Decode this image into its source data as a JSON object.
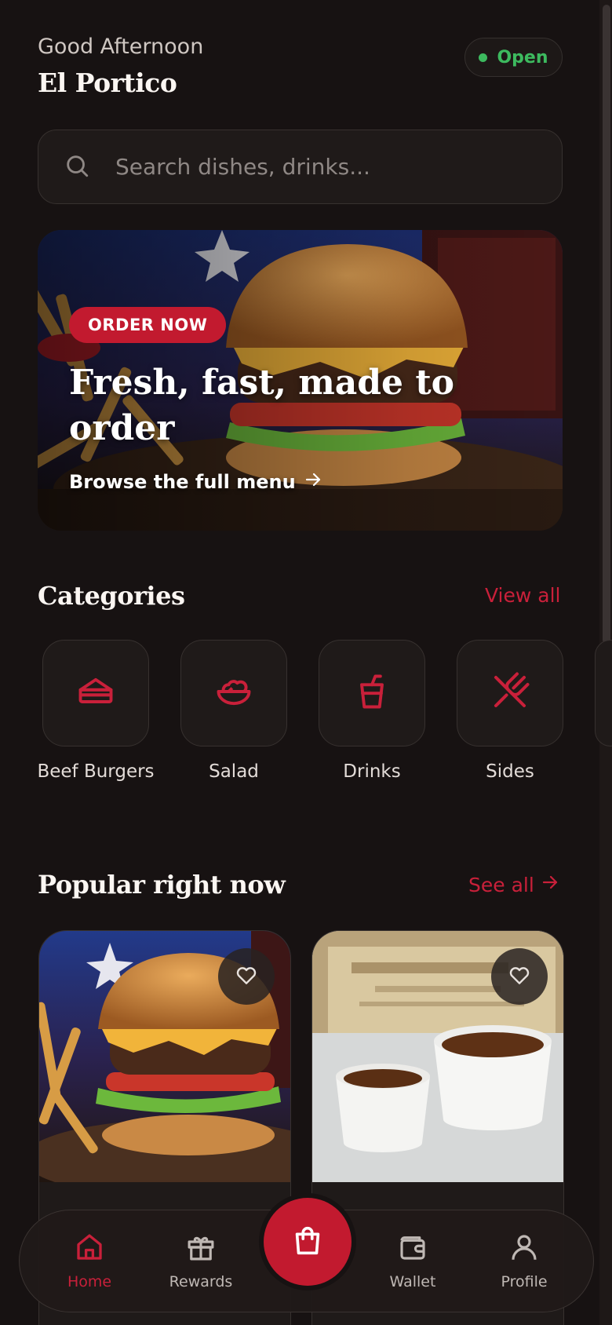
{
  "header": {
    "greeting": "Good Afternoon",
    "venue": "El Portico"
  },
  "status": {
    "label": "Open",
    "color": "#3dba5f"
  },
  "search": {
    "placeholder": "Search dishes, drinks..."
  },
  "hero": {
    "badge": "ORDER NOW",
    "title": "Fresh, fast, made to order",
    "link": "Browse the full menu"
  },
  "categories": {
    "title": "Categories",
    "view_all": "View all",
    "items": [
      {
        "label": "Beef Burgers",
        "icon": "sandwich-icon"
      },
      {
        "label": "Salad",
        "icon": "salad-bowl-icon"
      },
      {
        "label": "Drinks",
        "icon": "cup-icon"
      },
      {
        "label": "Sides",
        "icon": "utensils-icon"
      }
    ]
  },
  "popular": {
    "title": "Popular right now",
    "see_all": "See all"
  },
  "nav": {
    "items": [
      {
        "label": "Home",
        "icon": "home-icon",
        "active": true
      },
      {
        "label": "Rewards",
        "icon": "gift-icon",
        "active": false
      },
      {
        "label": "Wallet",
        "icon": "wallet-icon",
        "active": false
      },
      {
        "label": "Profile",
        "icon": "user-icon",
        "active": false
      }
    ],
    "cart_icon": "shopping-bag-icon"
  },
  "colors": {
    "accent": "#c21a2f",
    "background": "#171212",
    "surface": "#1f1a19"
  }
}
